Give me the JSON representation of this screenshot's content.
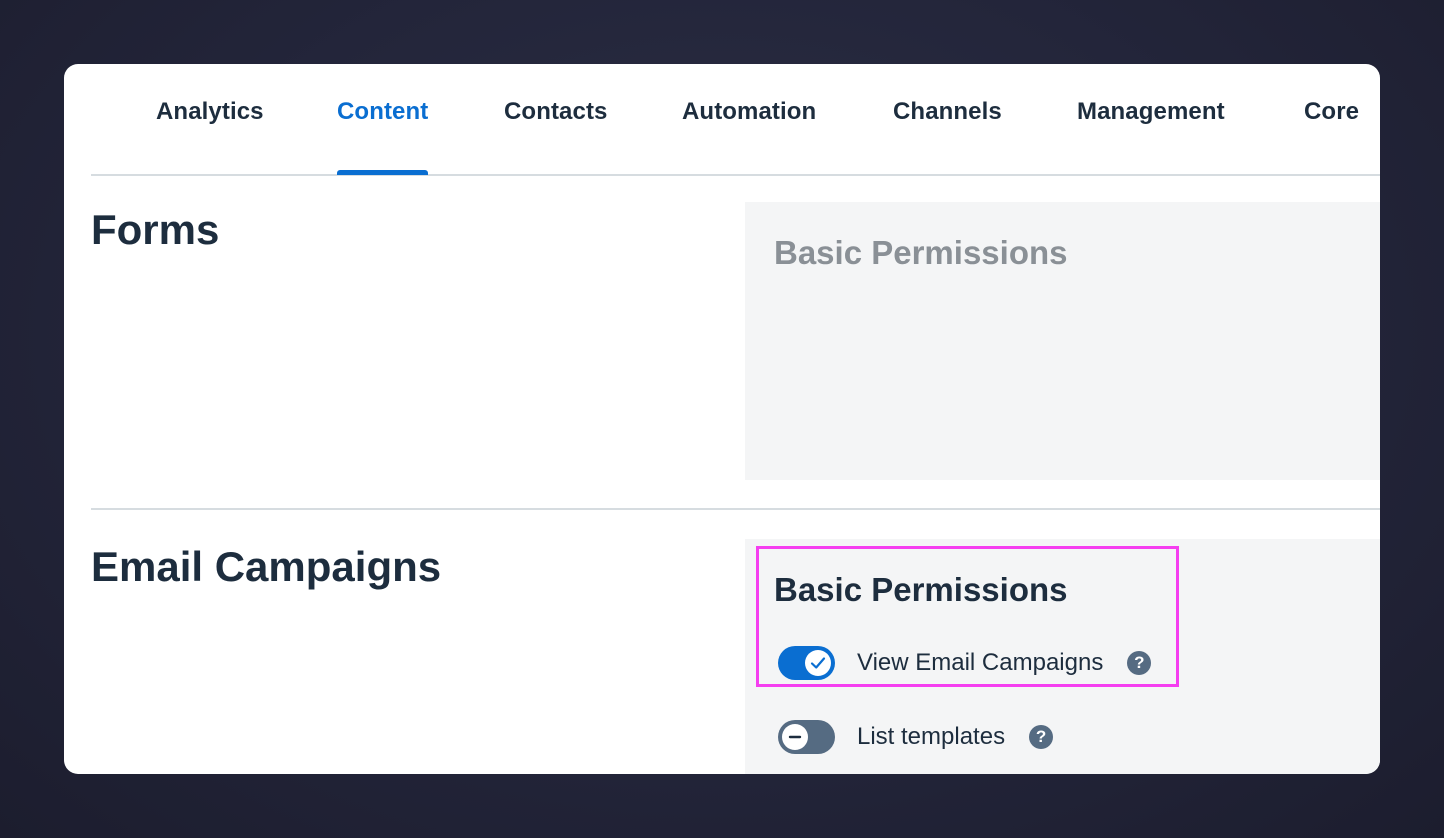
{
  "tabs": [
    {
      "label": "Analytics"
    },
    {
      "label": "Content"
    },
    {
      "label": "Contacts"
    },
    {
      "label": "Automation"
    },
    {
      "label": "Channels"
    },
    {
      "label": "Management"
    },
    {
      "label": "Core"
    }
  ],
  "active_tab": "Content",
  "sections": {
    "forms": {
      "title": "Forms",
      "panel_heading": "Basic Permissions"
    },
    "email_campaigns": {
      "title": "Email Campaigns",
      "panel_heading": "Basic Permissions",
      "permissions": [
        {
          "label": "View Email Campaigns",
          "enabled": true,
          "help_icon": "?"
        },
        {
          "label": "List templates",
          "enabled": false,
          "help_icon": "?"
        }
      ]
    }
  },
  "colors": {
    "accent": "#0a6ed1",
    "text": "#1d2d3e",
    "highlight": "#f53ef0",
    "toggle_off": "#556b82"
  },
  "icons": {
    "check": "check-icon",
    "minus": "minus-icon",
    "help": "help-icon"
  }
}
